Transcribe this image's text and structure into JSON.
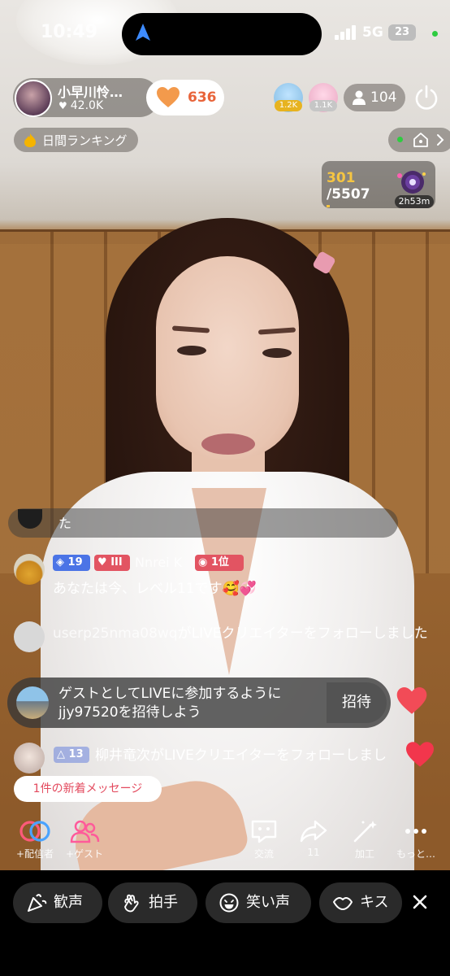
{
  "status_bar": {
    "time": "10:49",
    "network": "5G",
    "battery": "23"
  },
  "host": {
    "name": "小早川怜…",
    "likes": "42.0K",
    "follow_count": "636"
  },
  "top_gifters": [
    {
      "badge": "1.2K"
    },
    {
      "badge": "1.1K"
    }
  ],
  "viewers": "104",
  "ranking": {
    "label": "日間ランキング"
  },
  "score": {
    "current": "301",
    "target": "/5507",
    "timer": "2h53m"
  },
  "chat": {
    "partial": "た",
    "messages": [
      {
        "level": "19",
        "fan_level": "III",
        "name": "Nnrei K",
        "rank": "1位",
        "text": "あなたは今、レベル11です🥰💞"
      },
      {
        "user": "userp25nma08wq",
        "text": "がLIVEクリエイターをフォローしました"
      },
      {
        "level": "13",
        "text": "柳井竜次がLIVEクリエイターをフォローしまし"
      }
    ]
  },
  "invite": {
    "text": "ゲストとしてLIVEに参加するようにjjy97520を招待しよう",
    "button": "招待"
  },
  "new_message": "1件の新着メッセージ",
  "actions": {
    "host": "+配信者",
    "guest": "+ゲスト",
    "chat": "交流",
    "share": "11",
    "edit": "加工",
    "more": "もっと…"
  },
  "quick_reactions": [
    "歓声",
    "拍手",
    "笑い声",
    "キス"
  ],
  "colors": {
    "accent": "#e34a5e",
    "score_gold": "#f5c542",
    "follow_orange": "#e8643a"
  }
}
